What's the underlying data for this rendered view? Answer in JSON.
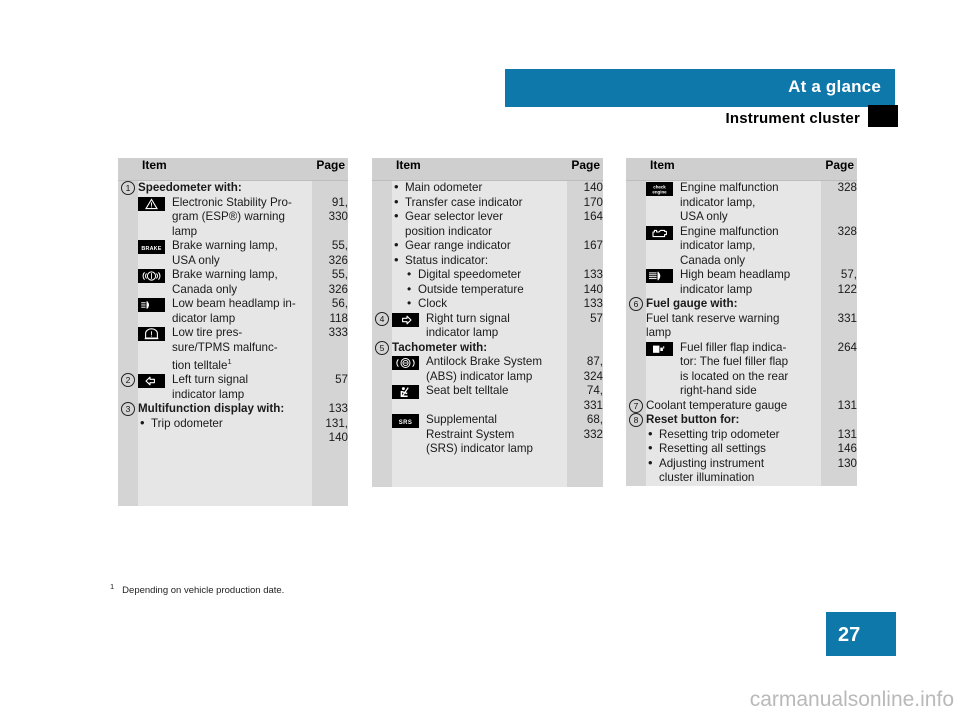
{
  "header": {
    "banner_title": "At a glance",
    "subtitle": "Instrument cluster"
  },
  "page_number": "27",
  "watermark": "carmanualsonline.info",
  "footnote": {
    "marker": "1",
    "text": "Depending on vehicle production date."
  },
  "columns": [
    {
      "header": {
        "item": "Item",
        "page": "Page"
      },
      "rows": [
        {
          "num": "1",
          "icon": "",
          "text": "Speedometer with:",
          "bold": true,
          "page": ""
        },
        {
          "num": "",
          "icon": "esp-warning-triangle",
          "text": "Electronic Stability Pro-\ngram (ESP®) warning\nlamp",
          "page": "91,\n330"
        },
        {
          "num": "",
          "icon": "brake-text",
          "text": "Brake warning lamp,\nUSA only",
          "page": "55,\n326"
        },
        {
          "num": "",
          "icon": "brake-circle",
          "text": "Brake warning lamp,\nCanada only",
          "page": "55,\n326"
        },
        {
          "num": "",
          "icon": "low-beam-headlamp",
          "text": "Low beam headlamp in-\ndicator lamp",
          "page": "56,\n118"
        },
        {
          "num": "",
          "icon": "tire-pressure",
          "text": "Low tire pres-\nsure/TPMS malfunc-\ntion telltale",
          "footnote": "1",
          "page": "333"
        },
        {
          "num": "2",
          "icon": "left-turn-arrow",
          "text": "Left turn signal\nindicator lamp",
          "page": "57"
        },
        {
          "num": "3",
          "icon": "",
          "text": "Multifunction display with:",
          "bold": true,
          "page": "133"
        },
        {
          "num": "",
          "bullet": 1,
          "text": "Trip odometer",
          "page": "131,\n140"
        }
      ]
    },
    {
      "header": {
        "item": "Item",
        "page": "Page"
      },
      "rows": [
        {
          "num": "",
          "bullet": 1,
          "text": "Main odometer",
          "page": "140"
        },
        {
          "num": "",
          "bullet": 1,
          "text": "Transfer case indicator",
          "page": "170"
        },
        {
          "num": "",
          "bullet": 1,
          "text": "Gear selector lever\nposition indicator",
          "page": "164"
        },
        {
          "num": "",
          "bullet": 1,
          "text": "Gear range indicator",
          "page": "167"
        },
        {
          "num": "",
          "bullet": 1,
          "text": "Status indicator:",
          "page": ""
        },
        {
          "num": "",
          "bullet": 2,
          "text": "Digital speedometer",
          "page": "133"
        },
        {
          "num": "",
          "bullet": 2,
          "text": "Outside temperature",
          "page": "140"
        },
        {
          "num": "",
          "bullet": 2,
          "text": "Clock",
          "page": "133"
        },
        {
          "num": "4",
          "icon": "right-turn-arrow",
          "text": "Right turn signal\nindicator lamp",
          "page": "57"
        },
        {
          "num": "5",
          "icon": "",
          "text": "Tachometer with:",
          "bold": true,
          "page": ""
        },
        {
          "num": "",
          "icon": "abs",
          "text": "Antilock Brake System\n(ABS) indicator lamp",
          "page": "87,\n324"
        },
        {
          "num": "",
          "icon": "seat-belt",
          "text": "Seat belt telltale",
          "page": "74,\n331"
        },
        {
          "num": "",
          "icon": "srs-text",
          "text": "Supplemental\nRestraint System\n(SRS) indicator lamp",
          "page": "68,\n332"
        }
      ]
    },
    {
      "header": {
        "item": "Item",
        "page": "Page"
      },
      "rows": [
        {
          "num": "",
          "icon": "check-engine-text",
          "text": "Engine malfunction\nindicator lamp,\nUSA only",
          "page": "328"
        },
        {
          "num": "",
          "icon": "engine-outline",
          "text": "Engine malfunction\nindicator lamp,\nCanada only",
          "page": "328"
        },
        {
          "num": "",
          "icon": "high-beam-headlamp",
          "text": "High beam headlamp\nindicator lamp",
          "page": "57,\n122"
        },
        {
          "num": "6",
          "icon": "",
          "text": "Fuel gauge with:",
          "bold": true,
          "page": ""
        },
        {
          "num": "",
          "icon": "",
          "plain": true,
          "text": "Fuel tank reserve warning\nlamp",
          "page": "331"
        },
        {
          "num": "",
          "icon": "fuel-filler-flap",
          "text": "Fuel filler flap indica-\ntor: The fuel filler flap\nis located on the rear\nright-hand side",
          "page": "264"
        },
        {
          "num": "7",
          "icon": "",
          "plain": true,
          "text": "Coolant temperature gauge",
          "page": "131"
        },
        {
          "num": "8",
          "icon": "",
          "text": "Reset button for:",
          "bold": true,
          "page": ""
        },
        {
          "num": "",
          "bullet": 1,
          "text": "Resetting trip odometer",
          "page": "131"
        },
        {
          "num": "",
          "bullet": 1,
          "text": "Resetting all settings",
          "page": "146"
        },
        {
          "num": "",
          "bullet": 1,
          "text": "Adjusting instrument\ncluster illumination",
          "page": "130"
        }
      ]
    }
  ],
  "colors": {
    "accent": "#0f78ab",
    "header_band": "#cfcfcf",
    "body_band": "#e6e6e6",
    "side_band": "#d4d4d4"
  }
}
